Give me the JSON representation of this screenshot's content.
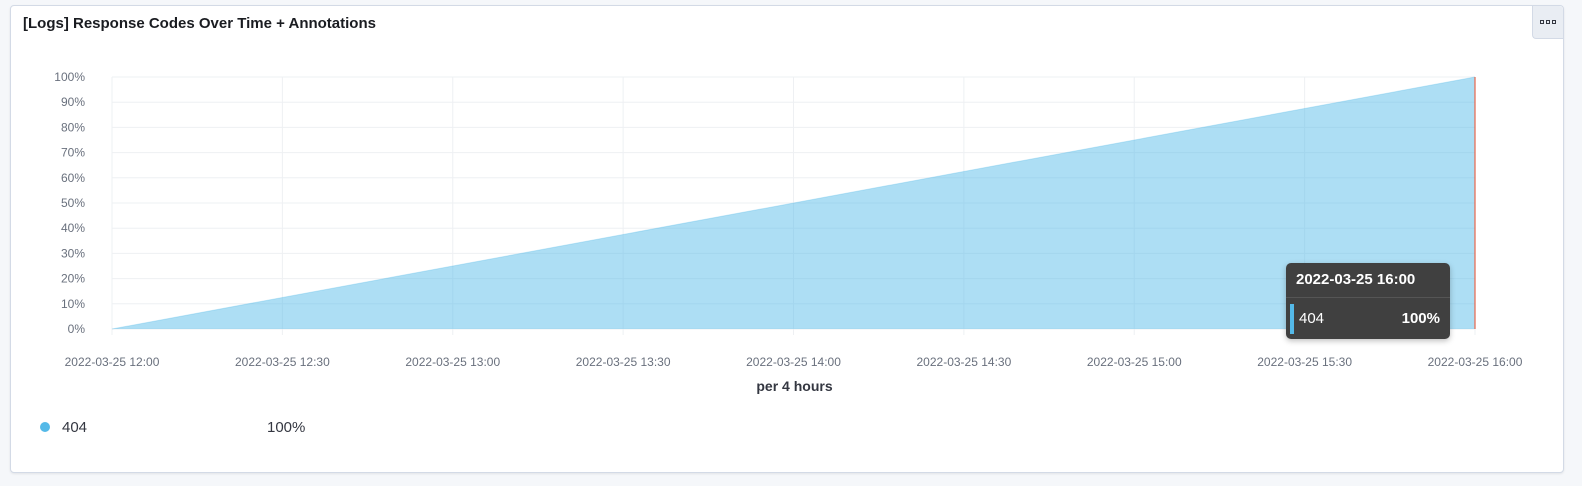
{
  "panel": {
    "title": "[Logs] Response Codes Over Time + Annotations"
  },
  "chart_data": {
    "type": "area",
    "x": [
      "2022-03-25 12:00",
      "2022-03-25 16:00"
    ],
    "series": [
      {
        "name": "404",
        "values": [
          0,
          100
        ],
        "color": "#54b9e8"
      }
    ],
    "x_ticks": [
      "2022-03-25 12:00",
      "2022-03-25 12:30",
      "2022-03-25 13:00",
      "2022-03-25 13:30",
      "2022-03-25 14:00",
      "2022-03-25 14:30",
      "2022-03-25 15:00",
      "2022-03-25 15:30",
      "2022-03-25 16:00"
    ],
    "y_ticks": [
      "0%",
      "10%",
      "20%",
      "30%",
      "40%",
      "50%",
      "60%",
      "70%",
      "80%",
      "90%",
      "100%"
    ],
    "ylim": [
      0,
      100
    ],
    "xlabel": "per 4 hours",
    "ylabel": "",
    "grid": true,
    "legend_position": "bottom-left",
    "annotation_marker": {
      "x": "2022-03-25 16:00",
      "color": "#e7664c"
    }
  },
  "legend": {
    "items": [
      {
        "name": "404",
        "value": "100%",
        "color": "#54b9e8"
      }
    ]
  },
  "tooltip": {
    "header": "2022-03-25 16:00",
    "series_name": "404",
    "value": "100%",
    "color": "#54b9e8"
  }
}
